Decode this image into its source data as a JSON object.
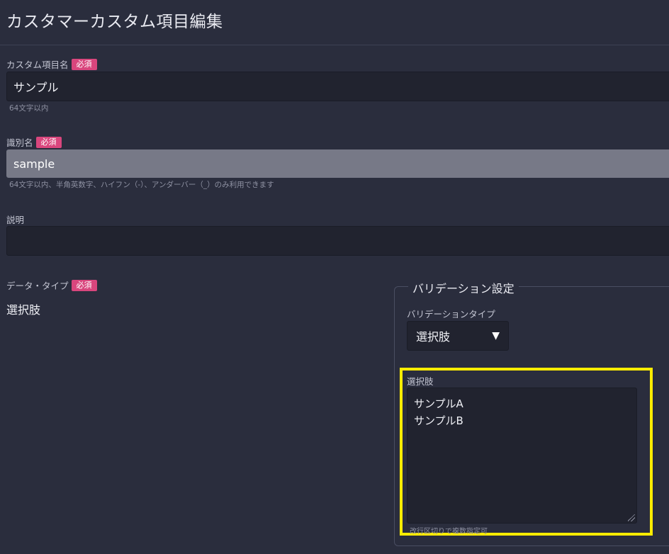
{
  "header": {
    "title": "カスタマーカスタム項目編集"
  },
  "required_badge": "必須",
  "fields": {
    "name": {
      "label": "カスタム項目名",
      "value": "サンプル",
      "hint": "64文字以内"
    },
    "identifier": {
      "label": "識別名",
      "value": "sample",
      "hint": "64文字以内、半角英数字、ハイフン（-）、アンダーバー（_）のみ利用できます"
    },
    "description": {
      "label": "説明",
      "value": ""
    },
    "data_type": {
      "label": "データ・タイプ",
      "value": "選択肢"
    }
  },
  "validation": {
    "legend": "バリデーション設定",
    "type_label": "バリデーションタイプ",
    "type_value": "選択肢",
    "choices_label": "選択肢",
    "choices": [
      "サンプルA",
      "サンプルB"
    ],
    "choices_hint": "改行区切りで複数指定可"
  },
  "colors": {
    "background": "#2a2d3d",
    "badge": "#d9467d",
    "highlight": "#ffec00",
    "input_bg": "#21232f"
  },
  "icons": {
    "select_caret": "caret-down-icon",
    "resize": "resize-grip-icon"
  }
}
